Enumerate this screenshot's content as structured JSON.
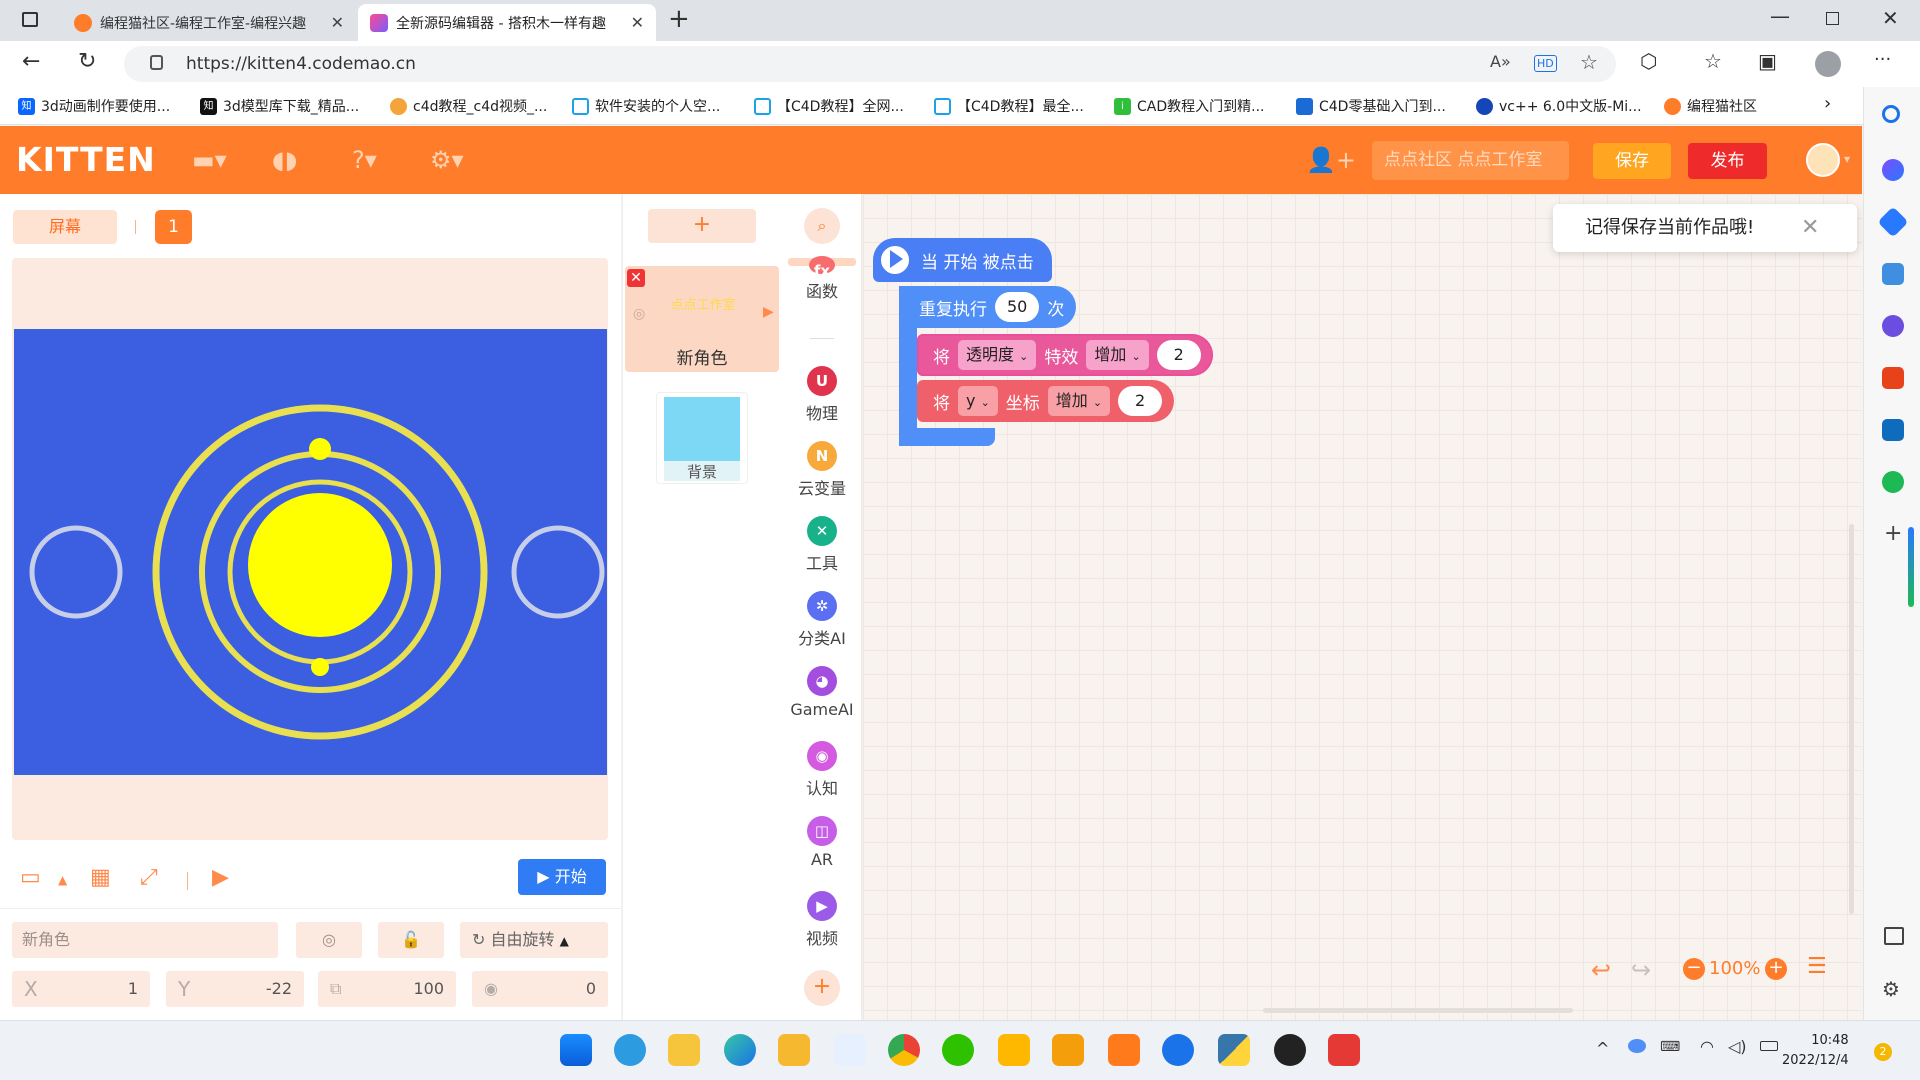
{
  "browser": {
    "tabs": [
      {
        "title": "编程猫社区-编程工作室-编程兴趣",
        "active": false
      },
      {
        "title": "全新源码编辑器 - 搭积木一样有趣",
        "active": true
      }
    ],
    "url": "https://kitten4.codemao.cn",
    "bookmarks": [
      "3d动画制作要使用...",
      "3d模型库下载_精品...",
      "c4d教程_c4d视频_...",
      "软件安装的个人空...",
      "【C4D教程】全网...",
      "【C4D教程】最全...",
      "CAD教程入门到精...",
      "C4D零基础入门到...",
      "vc++ 6.0中文版-Mi...",
      "编程猫社区"
    ]
  },
  "app": {
    "logo": "KITTEN",
    "search_placeholder": "点点社区 点点工作室",
    "save_label": "保存",
    "publish_label": "发布",
    "brand_color": "#ff7c2a"
  },
  "stage": {
    "screen_label": "屏幕",
    "page_number": "1",
    "start_label": "开始",
    "sprite_name": "新角色",
    "rotation_mode": "自由旋转",
    "x_label": "X",
    "x_value": "1",
    "y_label": "Y",
    "y_value": "-22",
    "size_value": "100",
    "rotation_value": "0"
  },
  "sprites": {
    "add_label": "+",
    "sprite_label": "新角色",
    "sprite_thumb_text": "点点工作室",
    "background_label": "背景"
  },
  "categories": [
    "函数",
    "物理",
    "云变量",
    "工具",
    "分类AI",
    "GameAI",
    "认知",
    "AR",
    "视频"
  ],
  "blocks": {
    "hat": "当 开始 被点击",
    "repeat_label": "重复执行",
    "repeat_count": "50",
    "repeat_suffix": "次",
    "set1_prefix": "将",
    "set1_dropdown": "透明度",
    "set1_mid": "特效",
    "set1_op": "增加",
    "set1_value": "2",
    "set2_prefix": "将",
    "set2_dropdown": "y",
    "set2_mid": "坐标",
    "set2_op": "增加",
    "set2_value": "2"
  },
  "toast": "记得保存当前作品哦!",
  "zoom_level": "100%",
  "clock": {
    "time": "10:48",
    "date": "2022/12/4"
  }
}
